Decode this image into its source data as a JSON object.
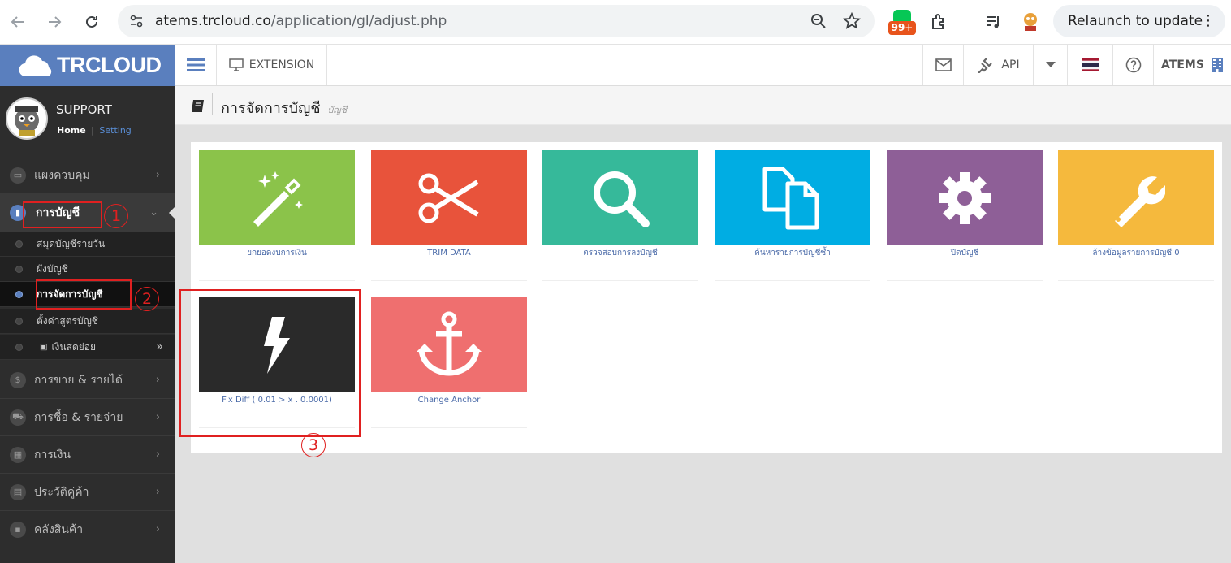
{
  "browser": {
    "url_domain": "atems.trcloud.co",
    "url_path": "/application/gl/adjust.php",
    "ext_badge": "99+",
    "relaunch_label": "Relaunch to update"
  },
  "header": {
    "logo_text": "TRCLOUD",
    "extension_label": "EXTENSION",
    "api_label": "API",
    "company_label": "ATEMS"
  },
  "profile": {
    "name": "SUPPORT",
    "home_link": "Home",
    "separator": "|",
    "setting_link": "Setting"
  },
  "sidebar": {
    "items": [
      {
        "label": "แผงควบคุม",
        "icon": "monitor-icon"
      },
      {
        "label": "การบัญชี",
        "icon": "book-icon"
      },
      {
        "label": "การขาย & รายได้",
        "icon": "dollar-icon"
      },
      {
        "label": "การซื้อ & รายจ่าย",
        "icon": "cart-icon"
      },
      {
        "label": "การเงิน",
        "icon": "calendar-icon"
      },
      {
        "label": "ประวัติคู่ค้า",
        "icon": "contact-icon"
      },
      {
        "label": "คลังสินค้า",
        "icon": "cubes-icon"
      }
    ],
    "sub_items": [
      {
        "label": "สมุดบัญชีรายวัน"
      },
      {
        "label": "ผังบัญชี"
      },
      {
        "label": "การจัดการบัญชี"
      },
      {
        "label": "ตั้งค่าสูตรบัญชี"
      },
      {
        "label": "เงินสดย่อย"
      }
    ]
  },
  "page": {
    "title": "การจัดการบัญชี",
    "subtitle": "บัญชี"
  },
  "tiles": [
    {
      "label": "ยกยอดงบการเงิน",
      "icon": "magic-wand-icon",
      "color": "#8bc34a"
    },
    {
      "label": "TRIM DATA",
      "icon": "scissors-icon",
      "color": "#e8533b"
    },
    {
      "label": "ตรวจสอบการลงบัญชี",
      "icon": "search-icon",
      "color": "#36b99a"
    },
    {
      "label": "ค้นหารายการบัญชีซ้ำ",
      "icon": "copy-icon",
      "color": "#00ade3"
    },
    {
      "label": "ปิดบัญชี",
      "icon": "gear-icon",
      "color": "#8e5f97"
    },
    {
      "label": "ล้างข้อมูลรายการบัญชี 0",
      "icon": "wrench-icon",
      "color": "#f5b93d"
    },
    {
      "label": "Fix Diff ( 0.01 > x . 0.0001)",
      "icon": "bolt-icon",
      "color": "#2a2a2a"
    },
    {
      "label": "Change Anchor",
      "icon": "anchor-icon",
      "color": "#ef6f6f"
    }
  ],
  "annotations": {
    "step1": "1",
    "step2": "2",
    "step3": "3"
  }
}
